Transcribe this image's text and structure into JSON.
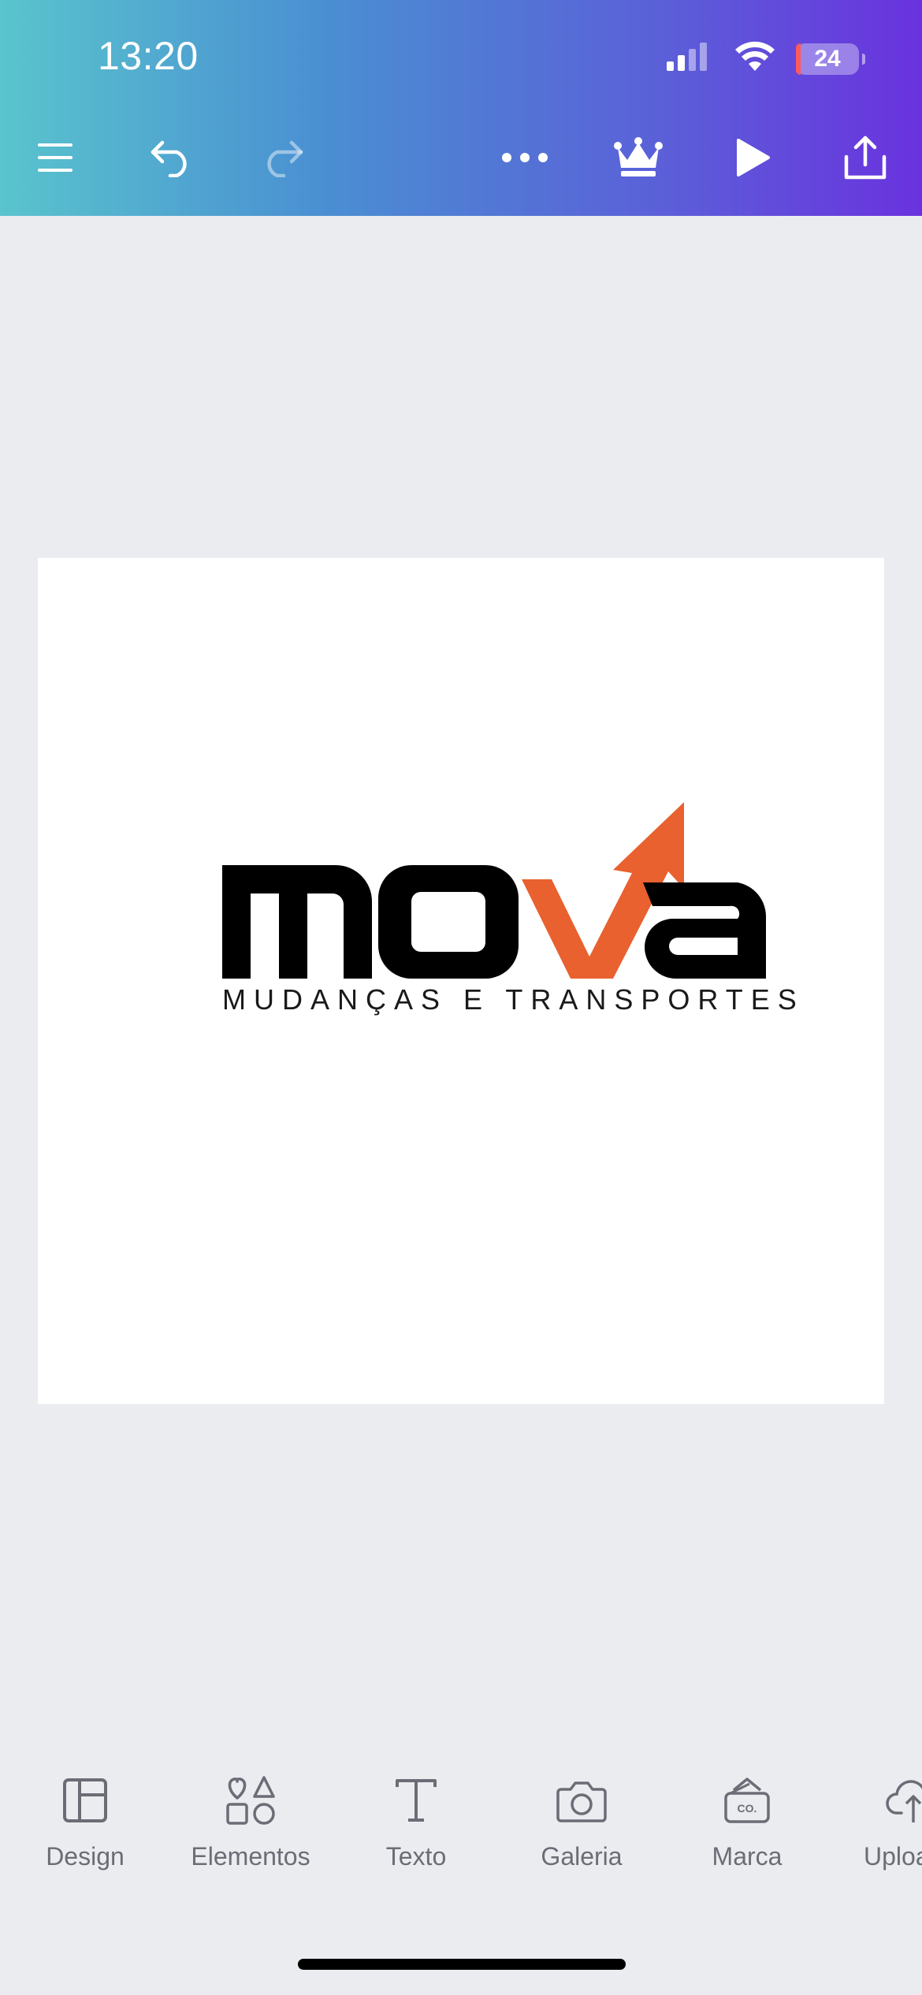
{
  "status_bar": {
    "time": "13:20",
    "battery_level": "24",
    "icons": [
      "cellular-signal-icon",
      "wifi-icon",
      "battery-icon"
    ]
  },
  "toolbar": {
    "icons": [
      "menu-icon",
      "undo-icon",
      "redo-icon",
      "more-icon",
      "crown-icon",
      "play-icon",
      "share-icon"
    ]
  },
  "canvas": {
    "logo": {
      "wordmark": "mova",
      "tagline": "MUDANÇAS E TRANSPORTES",
      "colors": {
        "text": "#000000",
        "accent": "#e8612f"
      }
    }
  },
  "bottom_nav": {
    "items": [
      {
        "label": "Design",
        "icon": "layout-icon"
      },
      {
        "label": "Elementos",
        "icon": "shapes-icon"
      },
      {
        "label": "Texto",
        "icon": "text-icon"
      },
      {
        "label": "Galeria",
        "icon": "camera-icon"
      },
      {
        "label": "Marca",
        "icon": "brand-icon"
      },
      {
        "label": "Uploads",
        "icon": "cloud-upload-icon"
      }
    ]
  },
  "colors": {
    "gradient_start": "#59c4cd",
    "gradient_end": "#6a32de",
    "background": "#ebecf0"
  }
}
